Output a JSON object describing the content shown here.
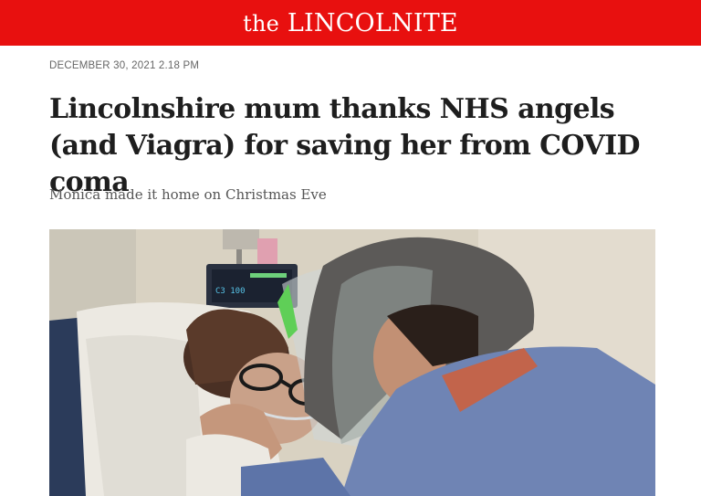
{
  "site": {
    "logo_prefix": "the",
    "logo_name": "LINCOLNITE",
    "brand_color": "#e8100f"
  },
  "article": {
    "dateline": "DECEMBER 30, 2021 2.18 PM",
    "headline": "Lincolnshire mum thanks NHS angels (and Viagra) for saving her from COVID coma",
    "standfirst": "Monica made it home on Christmas Eve"
  },
  "photo": {
    "monitor_readout": "C3 100"
  }
}
